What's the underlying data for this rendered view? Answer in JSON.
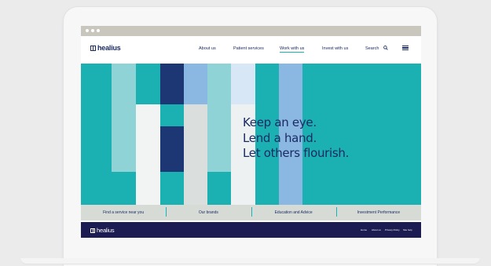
{
  "brand": {
    "name": "healius",
    "navy": "#1b2a63",
    "teal": "#1bb1b2",
    "footer_bg": "#1c1c52"
  },
  "browser": {
    "controls": [
      "dot",
      "dot",
      "dot"
    ]
  },
  "nav": {
    "links": [
      "About us",
      "Patient services",
      "Work with us",
      "Invest with us"
    ],
    "active": "Work with us",
    "search_label": "Search",
    "icons": {
      "search": "search-icon",
      "menu": "hamburger-menu-icon"
    }
  },
  "hero": {
    "headline": [
      "Keep an eye.",
      "Lend a hand.",
      "Let others flourish."
    ]
  },
  "quicklinks": [
    "Find a service near you",
    "Our brands",
    "Education and Advice",
    "Investment Performance"
  ],
  "footer": {
    "logo": "healius",
    "links": [
      "Home",
      "About us",
      "Privacy Policy",
      "Site help"
    ]
  }
}
